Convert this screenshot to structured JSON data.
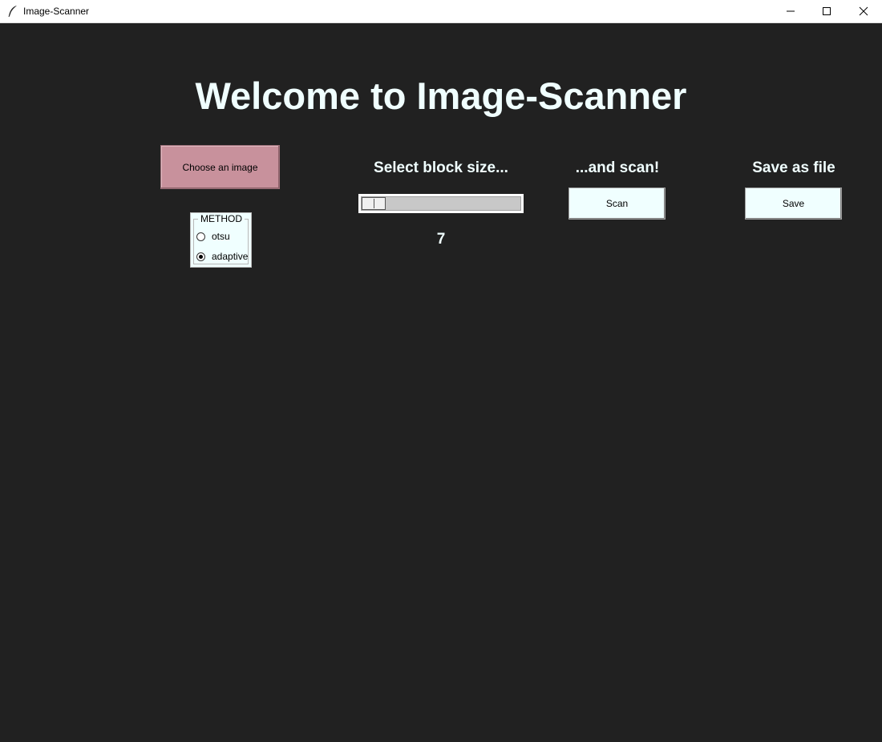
{
  "window": {
    "title": "Image-Scanner",
    "app_icon": "feather-icon",
    "controls": [
      "minimize-icon",
      "maximize-icon",
      "close-icon"
    ]
  },
  "main": {
    "heading": "Welcome to Image-Scanner",
    "choose_button": "Choose an image",
    "method": {
      "legend": "METHOD",
      "options": [
        {
          "label": "otsu",
          "selected": false
        },
        {
          "label": "adaptive",
          "selected": true
        }
      ]
    },
    "block_size": {
      "label": "Select block size...",
      "value": "7",
      "slider_fraction": 0.0
    },
    "scan": {
      "label": "...and scan!",
      "button": "Scan"
    },
    "save": {
      "label": "Save as file",
      "button": "Save"
    }
  },
  "colors": {
    "background": "#212121",
    "text": "#f0ffff",
    "choose_button": "#c8919c",
    "action_button": "#f0ffff"
  }
}
